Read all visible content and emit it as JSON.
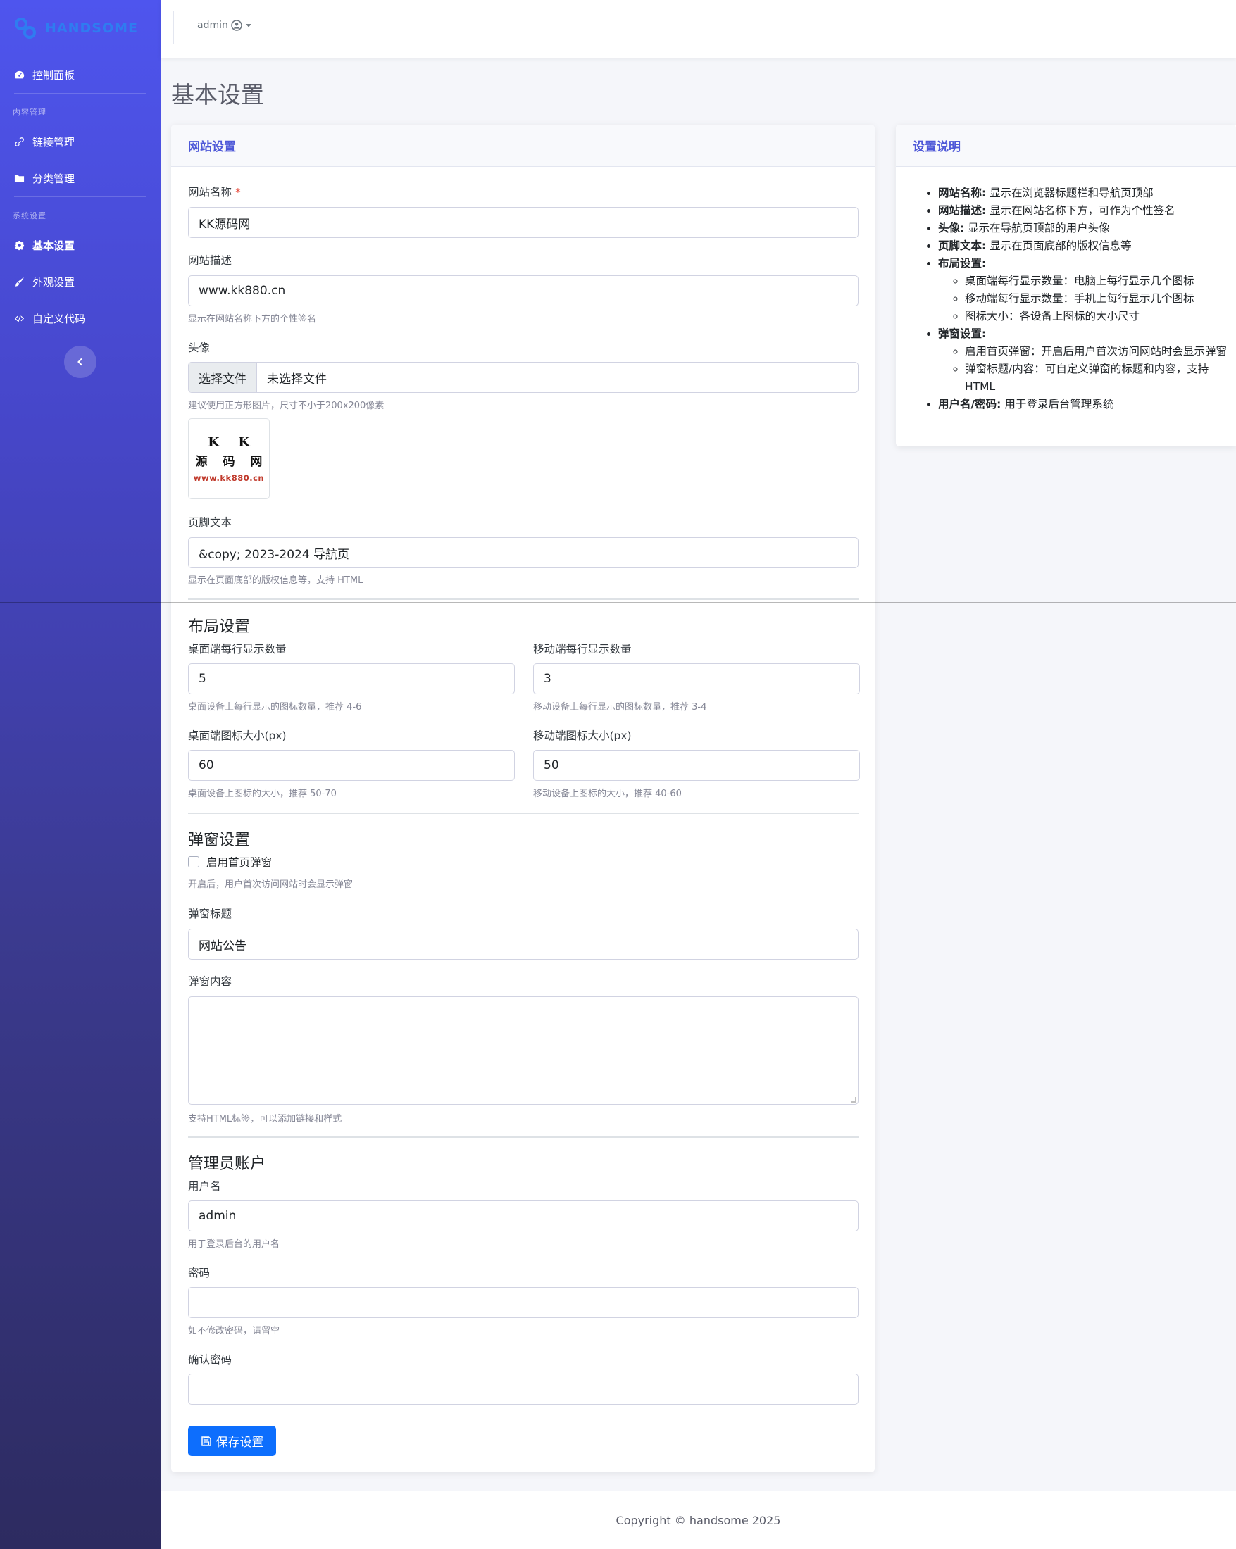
{
  "sidebar": {
    "brand": "HANDSOME",
    "items": [
      {
        "label": "控制面板"
      },
      {
        "label": "链接管理"
      },
      {
        "label": "分类管理"
      },
      {
        "label": "基本设置"
      },
      {
        "label": "外观设置"
      },
      {
        "label": "自定义代码"
      }
    ],
    "headings": {
      "content": "内容管理",
      "system": "系统设置"
    }
  },
  "topbar": {
    "user": "admin"
  },
  "page": {
    "title": "基本设置"
  },
  "form": {
    "header": "网站设置",
    "site_name": {
      "label": "网站名称",
      "required": "*",
      "value": "KK源码网"
    },
    "site_desc": {
      "label": "网站描述",
      "value": "www.kk880.cn",
      "hint": "显示在网站名称下方的个性签名"
    },
    "avatar": {
      "label": "头像",
      "button": "选择文件",
      "file_text": "未选择文件",
      "hint": "建议使用正方形图片，尺寸不小于200x200像素",
      "img_line1": "K K",
      "img_line2": "源 码 网",
      "img_line3": "www.kk880.cn"
    },
    "footer_text": {
      "label": "页脚文本",
      "value": "&copy; 2023-2024 导航页",
      "hint": "显示在页面底部的版权信息等，支持 HTML"
    },
    "layout": {
      "title": "布局设置",
      "desktop_count": {
        "label": "桌面端每行显示数量",
        "value": "5",
        "hint": "桌面设备上每行显示的图标数量，推荐 4-6"
      },
      "mobile_count": {
        "label": "移动端每行显示数量",
        "value": "3",
        "hint": "移动设备上每行显示的图标数量，推荐 3-4"
      },
      "desktop_size": {
        "label": "桌面端图标大小(px)",
        "value": "60",
        "hint": "桌面设备上图标的大小，推荐 50-70"
      },
      "mobile_size": {
        "label": "移动端图标大小(px)",
        "value": "50",
        "hint": "移动设备上图标的大小，推荐 40-60"
      }
    },
    "popup": {
      "title": "弹窗设置",
      "enable_label": "启用首页弹窗",
      "enable_checked": false,
      "enable_hint": "开启后，用户首次访问网站时会显示弹窗",
      "popup_title": {
        "label": "弹窗标题",
        "value": "网站公告"
      },
      "popup_content": {
        "label": "弹窗内容",
        "value": "",
        "hint": "支持HTML标签，可以添加链接和样式"
      }
    },
    "admin": {
      "title": "管理员账户",
      "username": {
        "label": "用户名",
        "value": "admin",
        "hint": "用于登录后台的用户名"
      },
      "password": {
        "label": "密码",
        "value": "",
        "hint": "如不修改密码，请留空"
      },
      "confirm": {
        "label": "确认密码",
        "value": ""
      }
    },
    "save_label": "保存设置"
  },
  "help": {
    "header": "设置说明",
    "items": [
      {
        "term": "网站名称:",
        "text": "显示在浏览器标题栏和导航页顶部"
      },
      {
        "term": "网站描述:",
        "text": "显示在网站名称下方，可作为个性签名"
      },
      {
        "term": "头像:",
        "text": "显示在导航页顶部的用户头像"
      },
      {
        "term": "页脚文本:",
        "text": "显示在页面底部的版权信息等"
      },
      {
        "term": "布局设置:",
        "sub": [
          "桌面端每行显示数量：电脑上每行显示几个图标",
          "移动端每行显示数量：手机上每行显示几个图标",
          "图标大小：各设备上图标的大小尺寸"
        ]
      },
      {
        "term": "弹窗设置:",
        "sub": [
          "启用首页弹窗：开启后用户首次访问网站时会显示弹窗",
          "弹窗标题/内容：可自定义弹窗的标题和内容，支持HTML"
        ]
      },
      {
        "term": "用户名/密码:",
        "text": "用于登录后台管理系统"
      }
    ]
  },
  "footer": {
    "copyright": "Copyright © handsome 2025"
  },
  "colors": {
    "accent": "#4e58d8",
    "primary_button": "#0d6efd",
    "sidebar_top": "#4e55ee",
    "sidebar_bottom": "#2d2b60"
  }
}
